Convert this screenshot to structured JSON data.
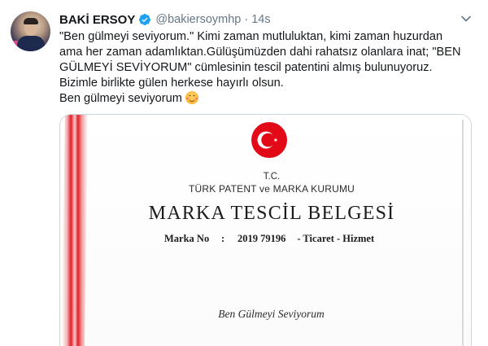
{
  "tweet": {
    "author_name": "BAKİ ERSOY",
    "handle": "@bakiersoymhp",
    "separator": "·",
    "time": "14s",
    "lines": [
      "\"Ben gülmeyi seviyorum.\" Kimi zaman mutluluktan, kimi zaman huzurdan",
      "ama her zaman adamlıktan.Gülüşümüzden dahi rahatsız olanlara inat; \"BEN",
      "GÜLMEYİ SEVİYORUM\" cümlesinin tescil patentini almış bulunuyoruz.",
      "Bizimle birlikte gülen herkese hayırlı olsun.",
      "Ben gülmeyi seviyorum"
    ],
    "emoji": "smiling-face-with-smiling-eyes",
    "verified_color": "#1da1f2"
  },
  "certificate": {
    "country": "T.C.",
    "institution": "TÜRK PATENT ve MARKA KURUMU",
    "title": "MARKA TESCİL BELGESİ",
    "mark_no_label": "Marka No",
    "mark_no_colon": ":",
    "mark_no_value": "2019 79196",
    "mark_type": "-  Ticaret - Hizmet",
    "signature_text": "Ben Gülmeyi Seviyorum",
    "ribbon_color": "#e21f26"
  }
}
